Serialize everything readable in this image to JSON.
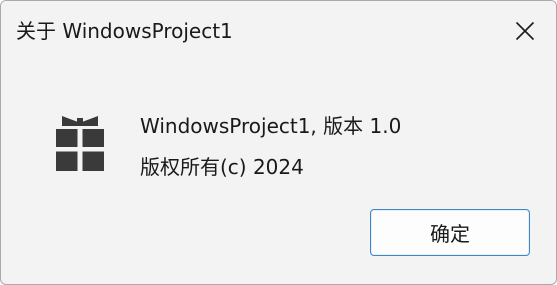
{
  "window": {
    "title": "关于 WindowsProject1",
    "close_icon": "close-icon"
  },
  "about": {
    "icon": "gift-icon",
    "version_line": "WindowsProject1, 版本 1.0",
    "copyright_line": "版权所有(c) 2024"
  },
  "buttons": {
    "ok_label": "确定"
  },
  "colors": {
    "dialog_background": "#f3f3f3",
    "button_border": "#3f86c9",
    "icon_color": "#3a3a3a"
  }
}
